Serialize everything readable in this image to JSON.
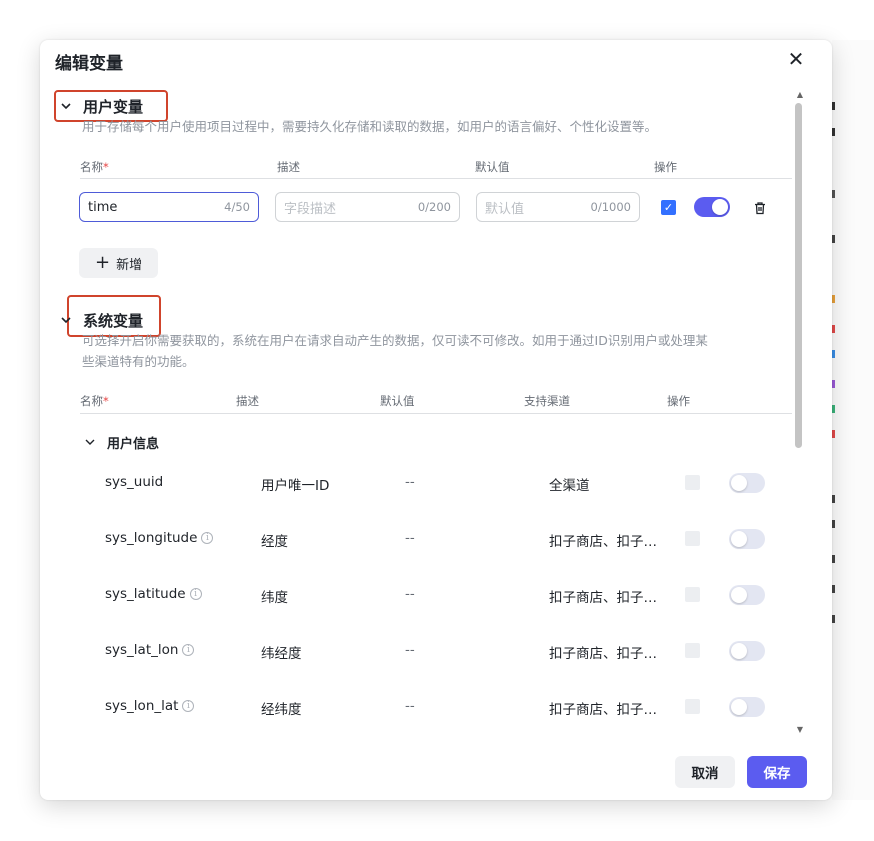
{
  "dialog": {
    "title": "编辑变量",
    "close_icon": "✕"
  },
  "user_vars": {
    "title": "用户变量",
    "description": "用于存储每个用户使用项目过程中，需要持久化存储和读取的数据，如用户的语言偏好、个性化设置等。",
    "columns": {
      "name": "名称",
      "required_mark": "*",
      "desc": "描述",
      "default": "默认值",
      "ops": "操作"
    },
    "row": {
      "name_value": "time",
      "name_count": "4/50",
      "desc_placeholder": "字段描述",
      "desc_count": "0/200",
      "default_placeholder": "默认值",
      "default_count": "0/1000",
      "checked": true,
      "enabled": true
    },
    "add_button": {
      "icon": "+",
      "label": "新增"
    }
  },
  "system_vars": {
    "title": "系统变量",
    "description_line1": "可选择开启你需要获取的，系统在用户在请求自动产生的数据，仅可读不可修改。如用于通过ID识别用户或处理某",
    "description_line2": "些渠道特有的功能。",
    "columns": {
      "name": "名称",
      "required_mark": "*",
      "desc": "描述",
      "default": "默认值",
      "channel": "支持渠道",
      "ops": "操作"
    },
    "group": {
      "title": "用户信息",
      "rows": [
        {
          "name": "sys_uuid",
          "info": false,
          "desc": "用户唯一ID",
          "default": "--",
          "channel": "全渠道"
        },
        {
          "name": "sys_longitude",
          "info": true,
          "desc": "经度",
          "default": "--",
          "channel": "扣子商店、扣子…"
        },
        {
          "name": "sys_latitude",
          "info": true,
          "desc": "纬度",
          "default": "--",
          "channel": "扣子商店、扣子…"
        },
        {
          "name": "sys_lat_lon",
          "info": true,
          "desc": "纬经度",
          "default": "--",
          "channel": "扣子商店、扣子…"
        },
        {
          "name": "sys_lon_lat",
          "info": true,
          "desc": "经纬度",
          "default": "--",
          "channel": "扣子商店、扣子…"
        }
      ]
    }
  },
  "footer": {
    "cancel": "取消",
    "save": "保存"
  },
  "icons": {
    "chevron": "chevron-down-icon",
    "info": "i",
    "check": "✓"
  },
  "colors": {
    "primary": "#5b5cf0",
    "checkbox": "#3370ff",
    "highlight": "#d0442c"
  }
}
